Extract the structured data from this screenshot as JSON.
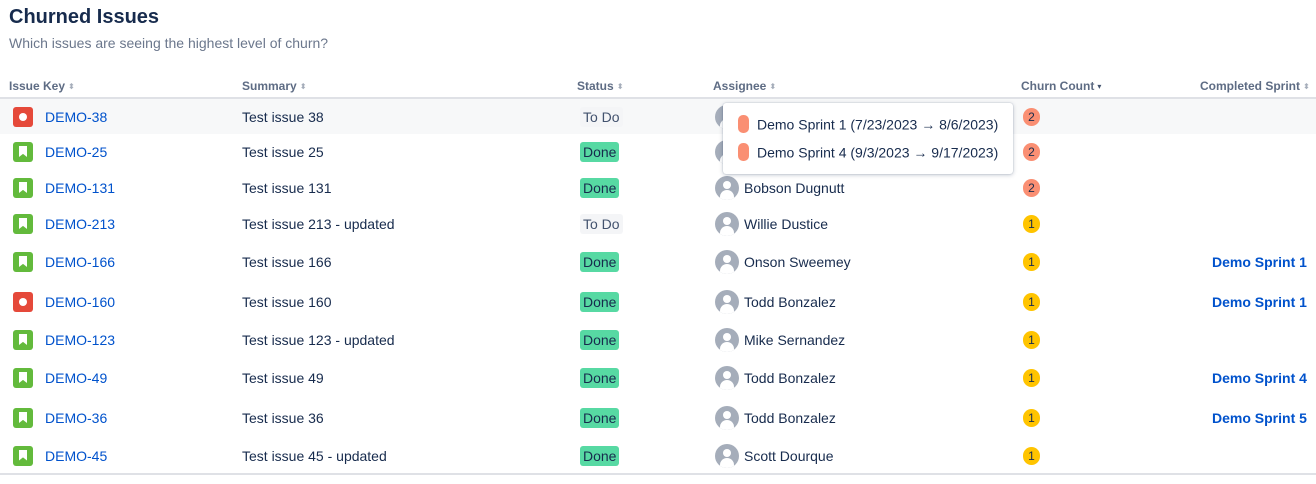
{
  "header": {
    "title": "Churned Issues",
    "subtitle": "Which issues are seeing the highest level of churn?"
  },
  "columns": [
    {
      "label": "Issue Key",
      "sort": "unsorted"
    },
    {
      "label": "Summary",
      "sort": "unsorted"
    },
    {
      "label": "Status",
      "sort": "unsorted"
    },
    {
      "label": "Assignee",
      "sort": "unsorted"
    },
    {
      "label": "Churn Count",
      "sort": "descending"
    },
    {
      "label": "Completed Sprint",
      "sort": "unsorted"
    }
  ],
  "rows": [
    {
      "type": "bug",
      "key": "DEMO-38",
      "summary": "Test issue 38",
      "status": "To Do",
      "assignee": "",
      "churn": "2",
      "sprint": ""
    },
    {
      "type": "story",
      "key": "DEMO-25",
      "summary": "Test issue 25",
      "status": "Done",
      "assignee": "",
      "churn": "2",
      "sprint": ""
    },
    {
      "type": "story",
      "key": "DEMO-131",
      "summary": "Test issue 131",
      "status": "Done",
      "assignee": "Bobson Dugnutt",
      "churn": "2",
      "sprint": ""
    },
    {
      "type": "story",
      "key": "DEMO-213",
      "summary": "Test issue 213 - updated",
      "status": "To Do",
      "assignee": "Willie Dustice",
      "churn": "1",
      "sprint": ""
    },
    {
      "type": "story",
      "key": "DEMO-166",
      "summary": "Test issue 166",
      "status": "Done",
      "assignee": "Onson Sweemey",
      "churn": "1",
      "sprint": "Demo Sprint 1"
    },
    {
      "type": "bug",
      "key": "DEMO-160",
      "summary": "Test issue 160",
      "status": "Done",
      "assignee": "Todd Bonzalez",
      "churn": "1",
      "sprint": "Demo Sprint 1"
    },
    {
      "type": "story",
      "key": "DEMO-123",
      "summary": "Test issue 123 - updated",
      "status": "Done",
      "assignee": "Mike Sernandez",
      "churn": "1",
      "sprint": ""
    },
    {
      "type": "story",
      "key": "DEMO-49",
      "summary": "Test issue 49",
      "status": "Done",
      "assignee": "Todd Bonzalez",
      "churn": "1",
      "sprint": "Demo Sprint 4"
    },
    {
      "type": "story",
      "key": "DEMO-36",
      "summary": "Test issue 36",
      "status": "Done",
      "assignee": "Todd Bonzalez",
      "churn": "1",
      "sprint": "Demo Sprint 5"
    },
    {
      "type": "story",
      "key": "DEMO-45",
      "summary": "Test issue 45 - updated",
      "status": "Done",
      "assignee": "Scott Dourque",
      "churn": "1",
      "sprint": ""
    }
  ],
  "tooltip": {
    "items": [
      "Demo Sprint 1 (7/23/2023 → 8/6/2023)",
      "Demo Sprint 4 (9/3/2023 → 9/17/2023)"
    ]
  },
  "icons": {
    "bug": "bug-icon",
    "story": "story-icon",
    "avatar": "user-avatar-icon",
    "sort": "sort-icon"
  },
  "colors": {
    "link": "#0052cc",
    "done": "#57d9a3",
    "todo": "#f4f5f7",
    "bug": "#e5493a",
    "story": "#63ba3c",
    "churn_high": "#fa8f73",
    "churn_low": "#ffc400"
  }
}
